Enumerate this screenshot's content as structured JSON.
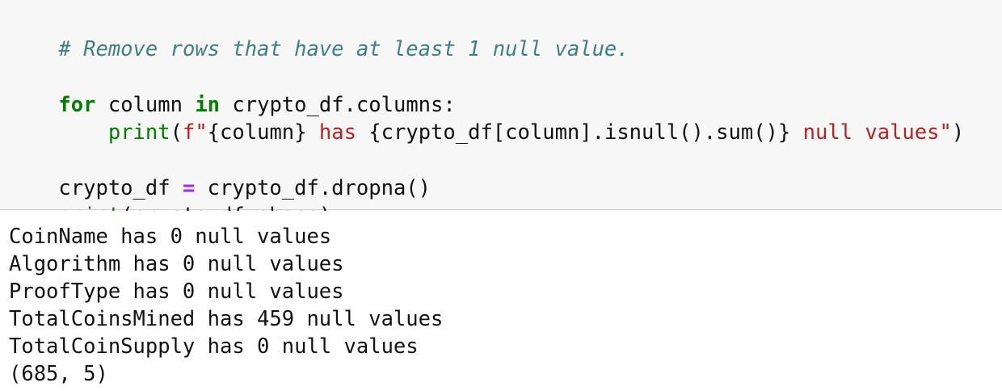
{
  "code_cell": {
    "comment_line": "# Remove rows that have at least 1 null value.",
    "line2": {
      "kw_for": "for",
      "var_column": " column ",
      "kw_in": "in",
      "iter": " crypto_df.columns:"
    },
    "line3": {
      "indent": "    ",
      "fn_print": "print",
      "open": "(",
      "str_f": "f\"",
      "fexpr1": "{column}",
      "str_has": " has ",
      "fexpr2": "{crypto_df[column].isnull().sum()}",
      "str_tail": " null values\"",
      "close": ")"
    },
    "line4": {
      "lhs": "crypto_df ",
      "op_eq": "=",
      "rhs": " crypto_df.dropna()"
    },
    "line5": {
      "fn_print": "print",
      "args": "(crypto_df.shape)"
    }
  },
  "output": {
    "lines": [
      "CoinName has 0 null values",
      "Algorithm has 0 null values",
      "ProofType has 0 null values",
      "TotalCoinsMined has 459 null values",
      "TotalCoinSupply has 0 null values",
      "(685, 5)"
    ]
  }
}
